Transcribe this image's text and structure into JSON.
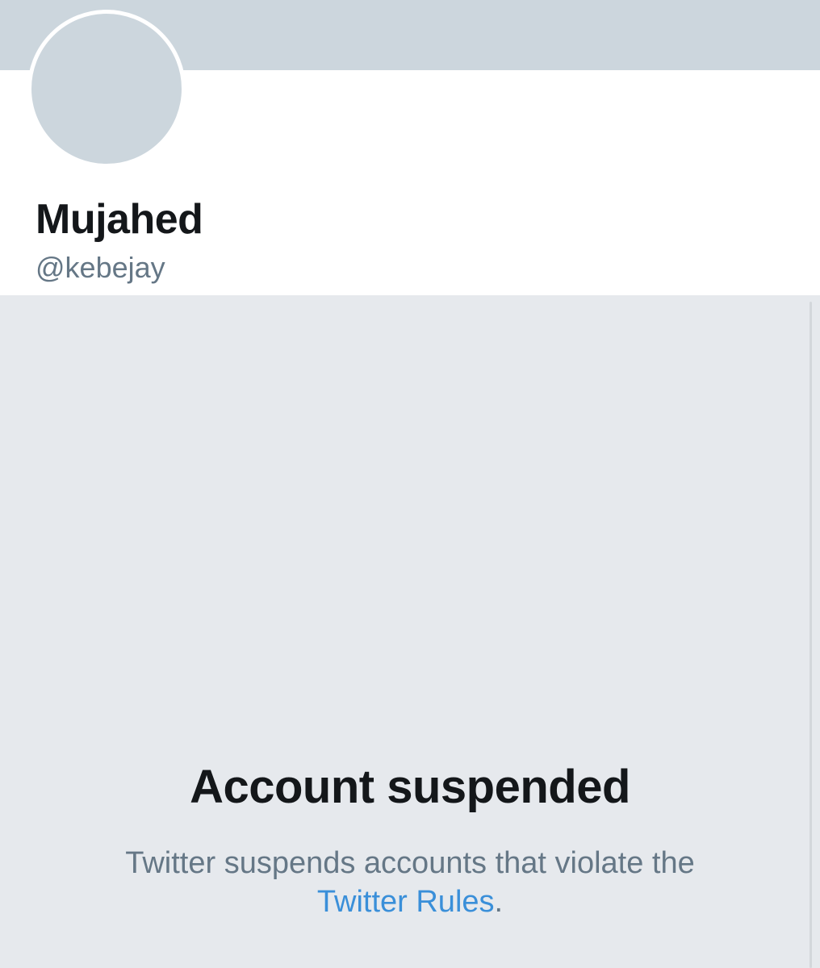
{
  "profile": {
    "display_name": "Mujahed",
    "handle": "@kebejay"
  },
  "suspension": {
    "title": "Account suspended",
    "message": "Twitter suspends accounts that violate the",
    "rules_link": "Twitter Rules",
    "period": "."
  },
  "colors": {
    "banner": "#ccd6dd",
    "avatar": "#ccd6dd",
    "background": "#e6e9ed",
    "link": "#3a8fd9",
    "primary_text": "#14171a",
    "secondary_text": "#657786"
  }
}
